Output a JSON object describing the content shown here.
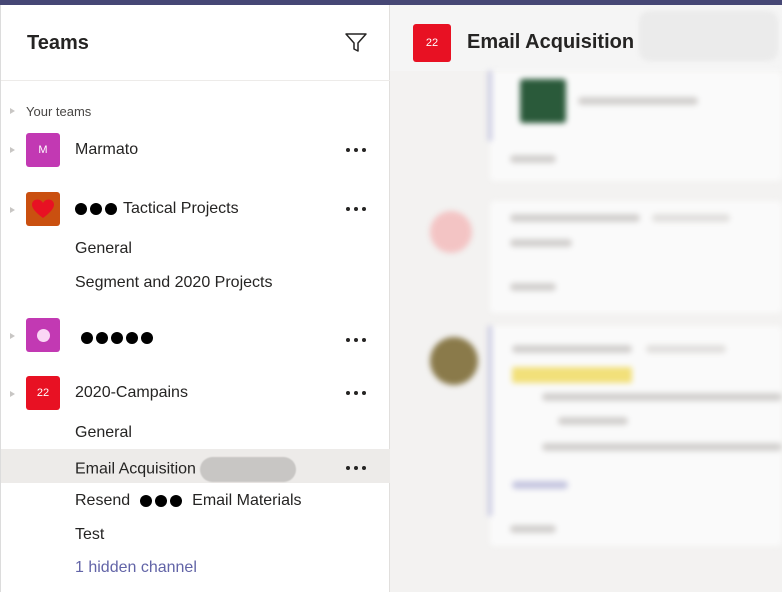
{
  "sidebar": {
    "title": "Teams",
    "section_label": "Your teams",
    "teams": [
      {
        "avatar_text": "M",
        "avatar_color": "#c239b3",
        "name": "Marmato"
      },
      {
        "avatar_color": "#ca5010",
        "name": "Tactical Projects",
        "avatar_icon": "heart-icon",
        "channels": [
          "General",
          "Segment and 2020 Projects"
        ]
      },
      {
        "avatar_color": "#c239b3",
        "avatar_icon": "circle-icon",
        "name": ""
      },
      {
        "avatar_text": "22",
        "avatar_color": "#e81123",
        "name": "2020-Campains",
        "channels": [
          "General",
          "Email Acquisition",
          "Resend",
          "Test"
        ],
        "channel_suffix": "Email Materials",
        "hidden_channels": "1 hidden channel"
      }
    ],
    "selected_channel": "Email Acquisition"
  },
  "main": {
    "avatar_text": "22",
    "title": "Email Acquisition"
  },
  "colors": {
    "accent": "#6264a7",
    "selected_bg": "#edebe9",
    "header_bar": "#464775"
  }
}
